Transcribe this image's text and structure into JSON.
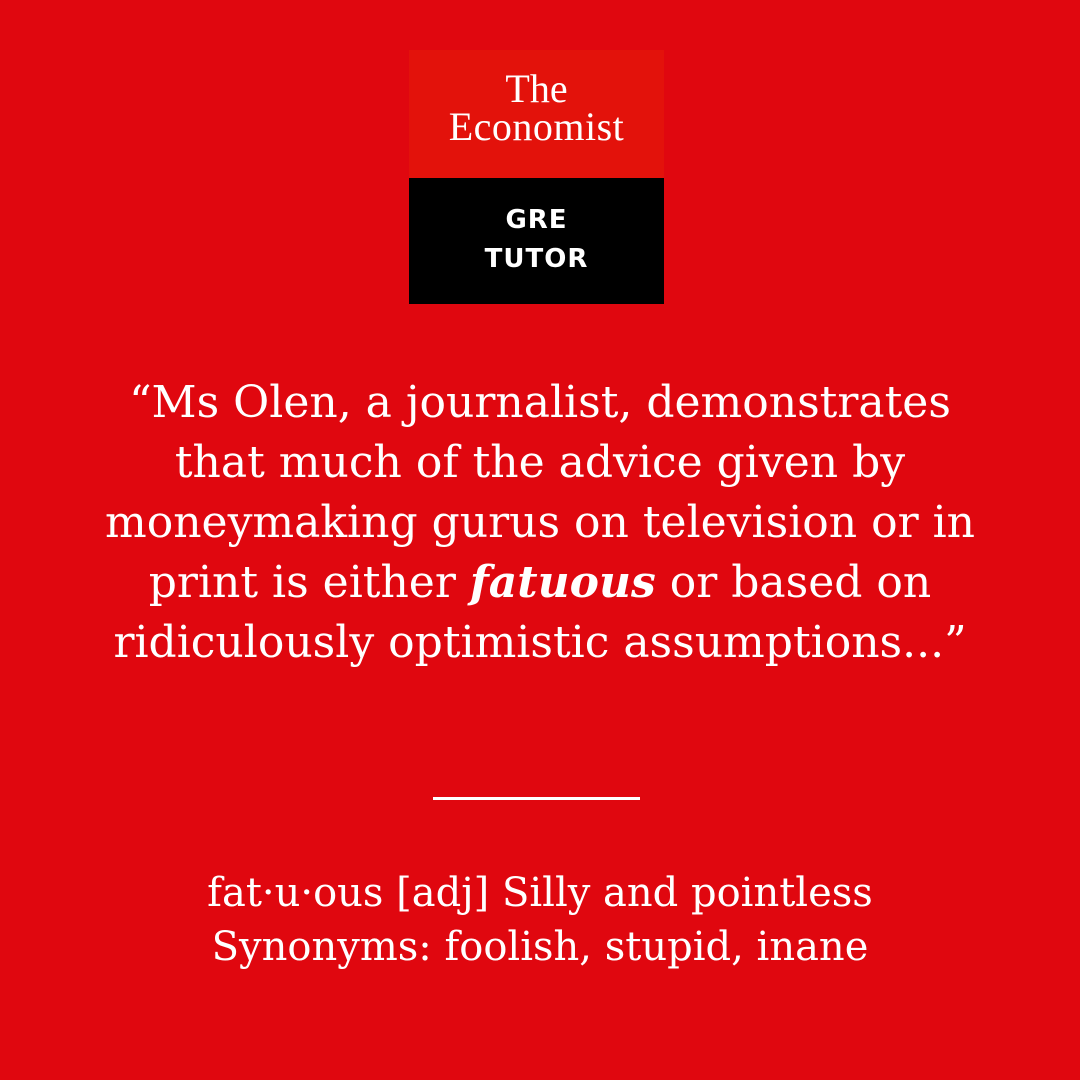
{
  "logo": {
    "brand_line1": "The",
    "brand_line2": "Economist",
    "product_line1": "GRE",
    "product_line2": "TUTOR"
  },
  "quote": {
    "before": "“Ms Olen, a journalist, demonstrates that much of the advice given by moneymaking gurus on television or in print is either ",
    "highlight": "fatuous",
    "after": " or based on ridiculously optimistic assumptions...”"
  },
  "definition": {
    "line1": "fat·u·ous [adj] Silly and pointless",
    "line2": "Synonyms: foolish, stupid, inane"
  },
  "colors": {
    "background": "#e0070f",
    "logo_red": "#e3120b",
    "logo_black": "#000000",
    "text": "#ffffff"
  }
}
